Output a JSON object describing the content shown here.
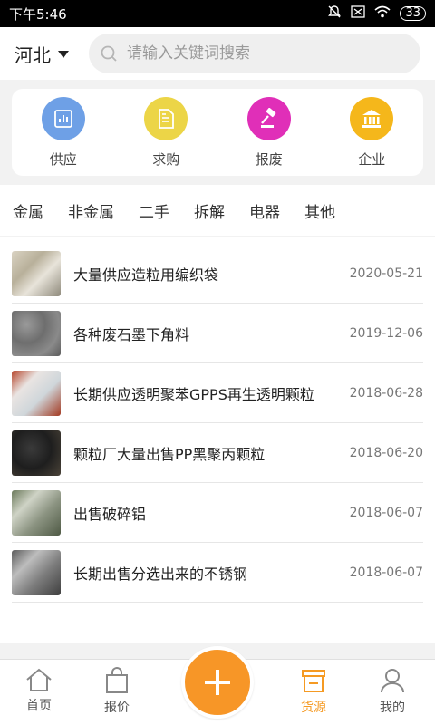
{
  "status": {
    "time": "下午5:46",
    "battery": "33"
  },
  "header": {
    "city": "河北",
    "search_placeholder": "请输入关键词搜索"
  },
  "categories": [
    {
      "label": "供应",
      "icon": "chart-icon",
      "color": "#6ea0e6"
    },
    {
      "label": "求购",
      "icon": "document-icon",
      "color": "#ecd547"
    },
    {
      "label": "报废",
      "icon": "gavel-icon",
      "color": "#e02fb8"
    },
    {
      "label": "企业",
      "icon": "bank-icon",
      "color": "#f5b71b"
    }
  ],
  "tabs": [
    "金属",
    "非金属",
    "二手",
    "拆解",
    "电器",
    "其他"
  ],
  "items": [
    {
      "title": "大量供应造粒用编织袋",
      "date": "2020-05-21"
    },
    {
      "title": "各种废石墨下角料",
      "date": "2019-12-06"
    },
    {
      "title": "长期供应透明聚苯GPPS再生透明颗粒",
      "date": "2018-06-28"
    },
    {
      "title": "颗粒厂大量出售PP黑聚丙颗粒",
      "date": "2018-06-20"
    },
    {
      "title": "出售破碎铝",
      "date": "2018-06-07"
    },
    {
      "title": "长期出售分选出来的不锈钢",
      "date": "2018-06-07"
    }
  ],
  "nav": {
    "home": "首页",
    "quote": "报价",
    "source": "货源",
    "mine": "我的"
  },
  "colors": {
    "accent": "#f79627"
  }
}
